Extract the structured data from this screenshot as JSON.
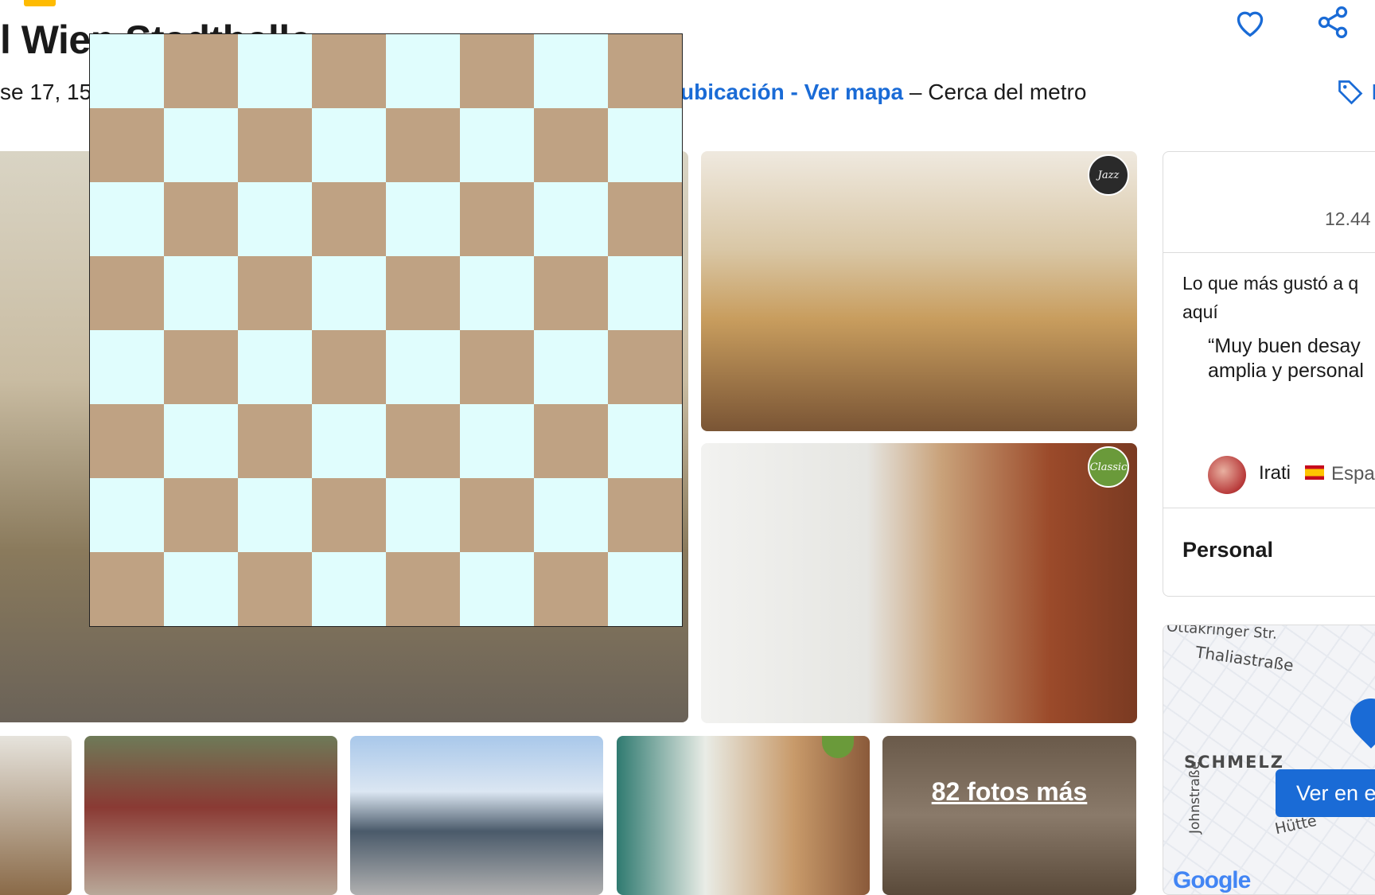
{
  "header": {
    "title": "l Wien Stadthalle",
    "address": "se 17, 15.",
    "location_link": "ubicación - Ver mapa",
    "location_tail": " – Cerca del metro",
    "price_tag_label": "I"
  },
  "gallery": {
    "badge_jazz": "Jazz",
    "badge_classic": "Classic",
    "more_photos": "82 fotos más"
  },
  "review_panel": {
    "count": "12.44",
    "heading": "Lo que más gustó a q aquí",
    "quote": "“Muy buen desay amplia y personal",
    "reviewer_name": "Irati",
    "reviewer_country": "Espa",
    "category": "Personal"
  },
  "map": {
    "streets": [
      "Ottakringer Str.",
      "Thaliastraße",
      "SCHMELZ",
      "Johnstraße",
      "Hütte"
    ],
    "button_label": "Ver en e",
    "attribution": "Google"
  },
  "colors": {
    "link_blue": "#1a6bd6",
    "board_light": "#e0fdfd",
    "board_dark": "#bfa283"
  }
}
